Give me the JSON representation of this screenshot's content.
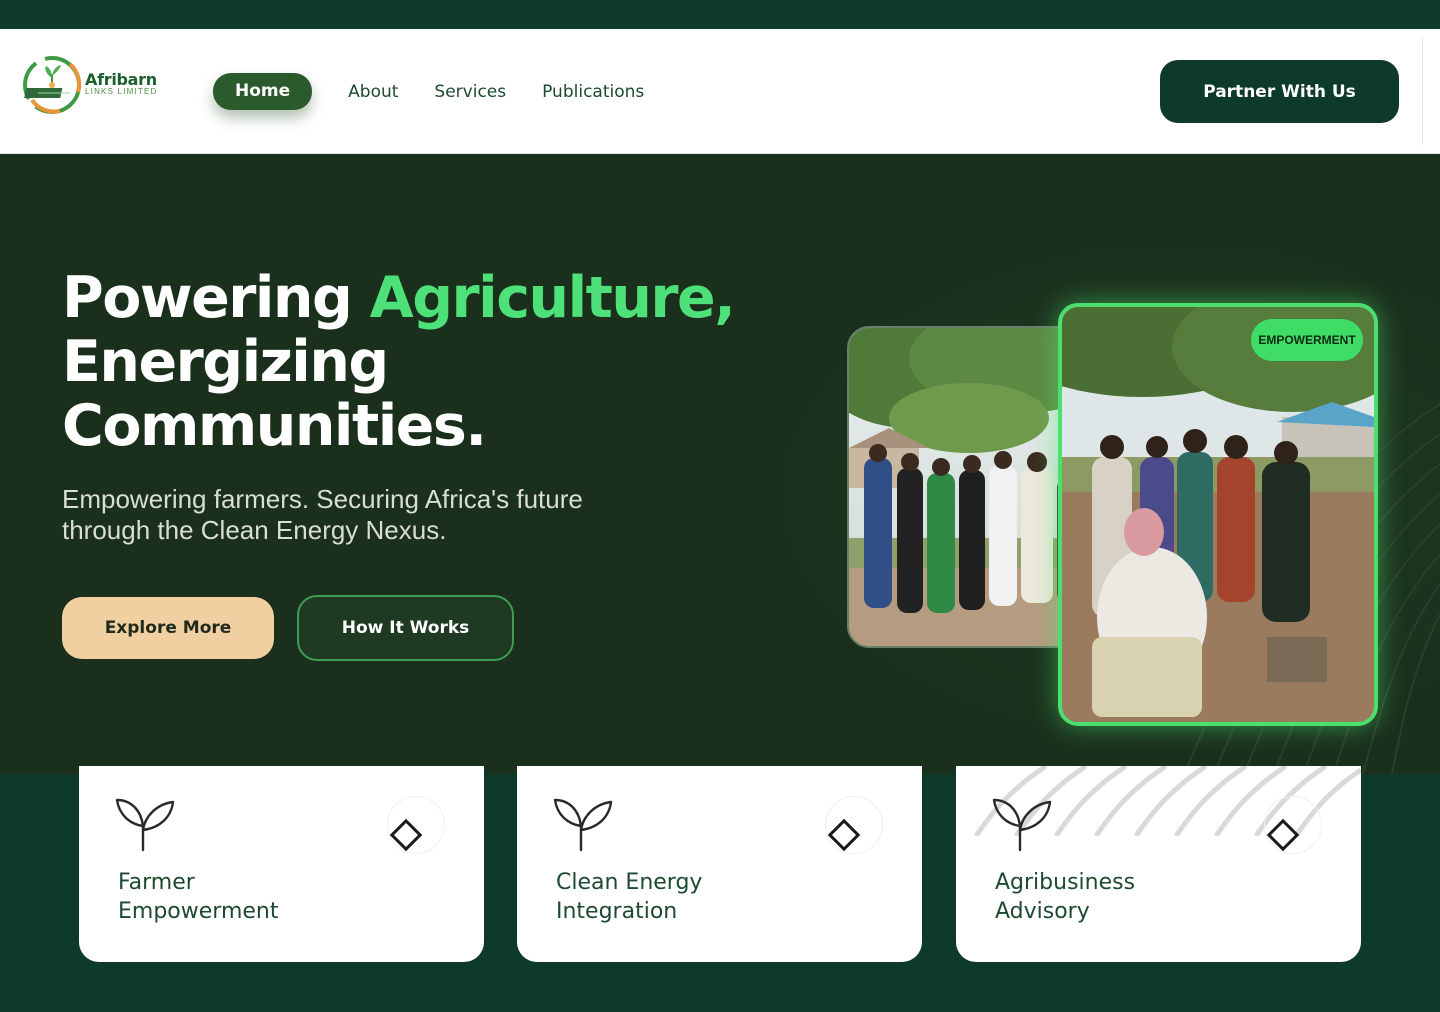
{
  "brand": {
    "name": "Afribarn",
    "tagline": "LINKS LIMITED"
  },
  "nav": {
    "links": [
      {
        "label": "Home",
        "active": true
      },
      {
        "label": "About"
      },
      {
        "label": "Services"
      },
      {
        "label": "Publications"
      }
    ],
    "cta": "Partner With Us"
  },
  "hero": {
    "title_part1": "Powering ",
    "title_accent": "Agriculture,",
    "title_line2": "Energizing",
    "title_line3": "Communities.",
    "subtitle": "Empowering farmers. Securing Africa's future through the Clean Energy Nexus.",
    "primary_button": "Explore More",
    "secondary_button": "How It Works",
    "badge": "EMPOWERMENT"
  },
  "services": [
    {
      "line1": "Farmer",
      "line2": "Empowerment"
    },
    {
      "line1": "Clean Energy",
      "line2": "Integration"
    },
    {
      "line1": "Agribusiness",
      "line2": "Advisory"
    }
  ],
  "colors": {
    "dark_green": "#0e3a2c",
    "hero_bg": "#1a2f1c",
    "accent_green": "#4ee17a",
    "cream": "#f0cfa1"
  }
}
